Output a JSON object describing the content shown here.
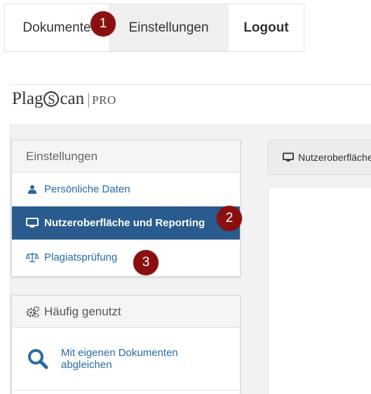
{
  "nav": {
    "documents_label": "Dokumente",
    "settings_label": "Einstellungen",
    "logout_label": "Logout"
  },
  "badges": [
    "1",
    "2",
    "3"
  ],
  "brand": {
    "name_prefix": "Plag",
    "name_s": "S",
    "name_suffix": "can",
    "edition": "PRO"
  },
  "settings_panel": {
    "title": "Einstellungen",
    "items": [
      {
        "label": "Persönliche Daten",
        "icon": "user-icon",
        "active": false
      },
      {
        "label": "Nutzeroberfläche und Reporting",
        "icon": "monitor-icon",
        "active": true
      },
      {
        "label": "Plagiatsprüfung",
        "icon": "scale-icon",
        "active": false
      }
    ]
  },
  "frequent_panel": {
    "title": "Häufig genutzt",
    "icon": "cogs-icon",
    "items": [
      {
        "label": "Mit eigenen Dokumenten abgleichen",
        "icon": "search-icon"
      }
    ]
  },
  "content": {
    "tab_label": "Nutzeroberfläche"
  },
  "colors": {
    "accent": "#2a5b8e",
    "link": "#2b6aa3",
    "badge": "#8b0f0f"
  }
}
